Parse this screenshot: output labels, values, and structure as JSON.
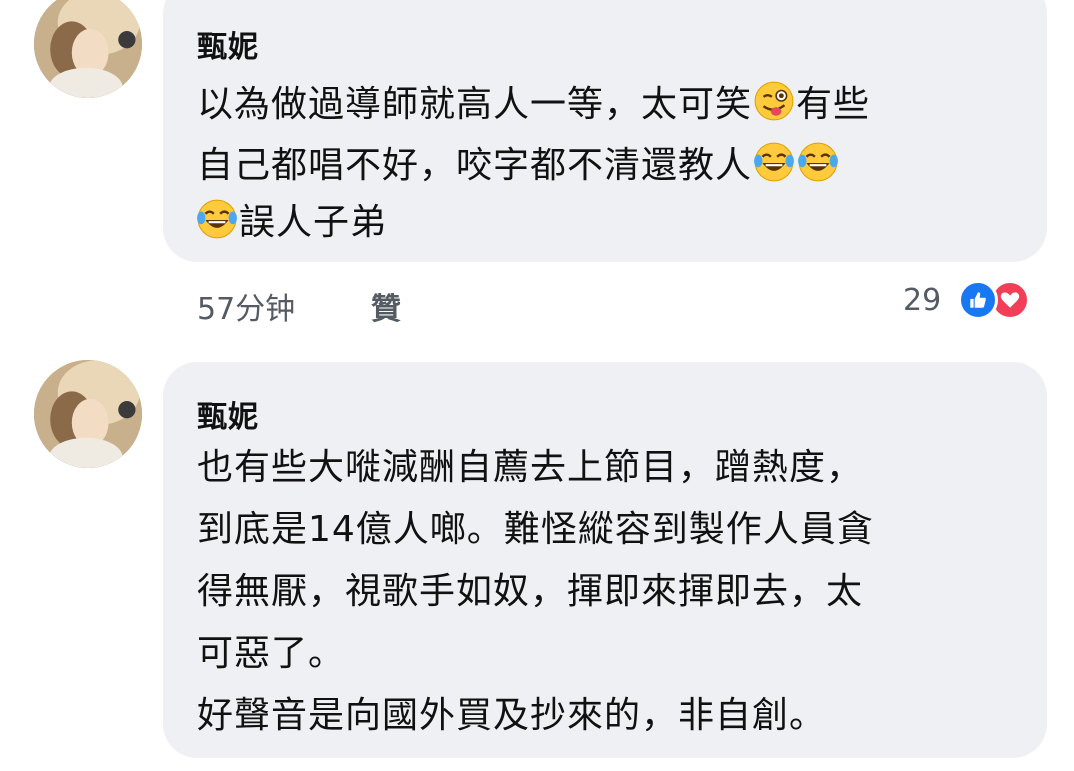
{
  "comments": [
    {
      "author": "甄妮",
      "lines": [
        [
          "以為做過導師就高人一等，太可笑",
          "有些"
        ],
        [
          "自己都唱不好，咬字都不清還教人",
          ""
        ],
        [
          "",
          "誤人子弟"
        ]
      ],
      "time": "57分钟",
      "like_label": "贊",
      "reaction_count": "29"
    },
    {
      "author": "甄妮",
      "lines": [
        "也有些大嘥減酬自薦去上節目，蹭熱度，",
        "到底是14億人啷。難怪縱容到製作人員貪",
        "得無厭，視歌手如奴，揮即來揮即去，太",
        "可惡了。",
        "好聲音是向國外買及抄來的，非自創。"
      ]
    }
  ],
  "icons": {
    "wink_emoji": "winking-face-with-tongue",
    "laugh_emoji": "face-with-tears-of-joy",
    "like_reaction": "thumbs-up",
    "love_reaction": "heart"
  },
  "colors": {
    "bubble": "#eef0f3",
    "like_blue": "#1877f2",
    "love_red": "#f33e58",
    "meta_gray": "#555b63"
  }
}
